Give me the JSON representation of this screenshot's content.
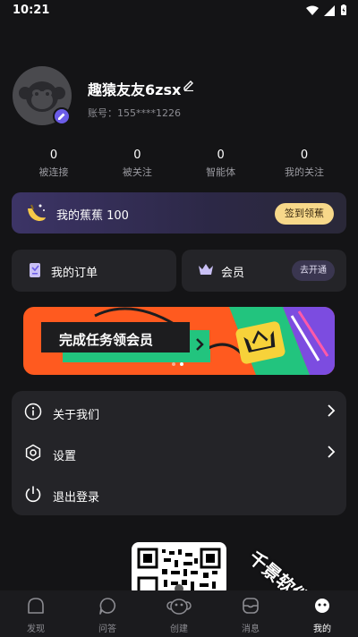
{
  "status_bar": {
    "time": "10:21"
  },
  "profile": {
    "nickname": "趣猿友友6zsx",
    "account": "账号：155****1226"
  },
  "stats": [
    {
      "value": "0",
      "label": "被连接"
    },
    {
      "value": "0",
      "label": "被关注"
    },
    {
      "value": "0",
      "label": "智能体"
    },
    {
      "value": "0",
      "label": "我的关注"
    }
  ],
  "banana": {
    "text": "我的蕉蕉 100",
    "button": "签到领蕉"
  },
  "cards": {
    "orders": "我的订单",
    "vip": "会员",
    "vip_button": "去开通"
  },
  "promo": {
    "text": "完成任务领会员"
  },
  "menu": {
    "about": "关于我们",
    "settings": "设置",
    "logout": "退出登录"
  },
  "watermark": "千景软件站",
  "tabs": [
    {
      "label": "发现"
    },
    {
      "label": "问答"
    },
    {
      "label": "创建"
    },
    {
      "label": "消息"
    },
    {
      "label": "我的"
    }
  ],
  "colors": {
    "background": "#141416",
    "card": "#242428",
    "accent_purple": "#6b5ce7",
    "sign_button": "#f7d88a",
    "promo_orange": "#ff5a1f",
    "promo_green": "#22c47e"
  }
}
